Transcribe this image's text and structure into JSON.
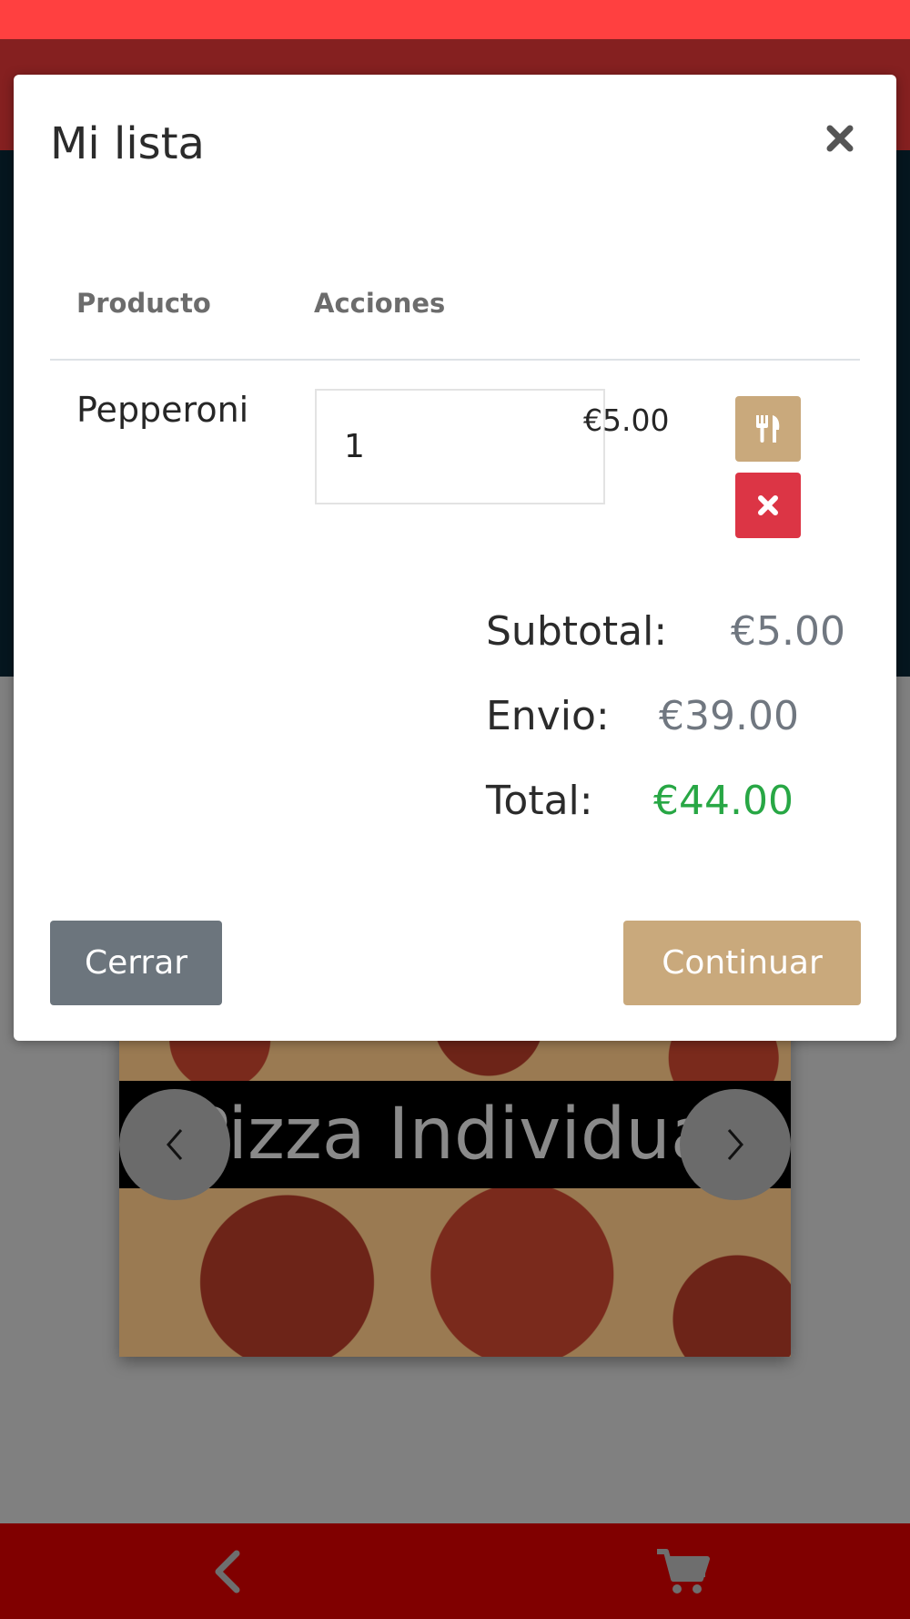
{
  "background": {
    "carousel_caption": "Pizza Individual"
  },
  "modal": {
    "title": "Mi lista",
    "columns": [
      "Producto",
      "Acciones"
    ],
    "items": [
      {
        "name": "Pepperoni",
        "quantity": "1",
        "price": "€5.00"
      }
    ],
    "summary": {
      "subtotal_label": "Subtotal:",
      "subtotal_value": "€5.00",
      "shipping_label": "Envio:",
      "shipping_value": "€39.00",
      "total_label": "Total:",
      "total_value": "€44.00"
    },
    "buttons": {
      "close_label": "Cerrar",
      "continue_label": "Continuar"
    }
  },
  "icons": {
    "close": "close-icon",
    "dine": "utensils-icon",
    "remove": "remove-icon",
    "prev": "chevron-left-icon",
    "next": "chevron-right-icon",
    "back": "back-arrow-icon",
    "cart": "cart-icon"
  },
  "colors": {
    "accent": "#c9a97c",
    "danger": "#dc3545",
    "total": "#28a745",
    "secondary": "#6c757d",
    "bottom_bar": "#800000"
  }
}
